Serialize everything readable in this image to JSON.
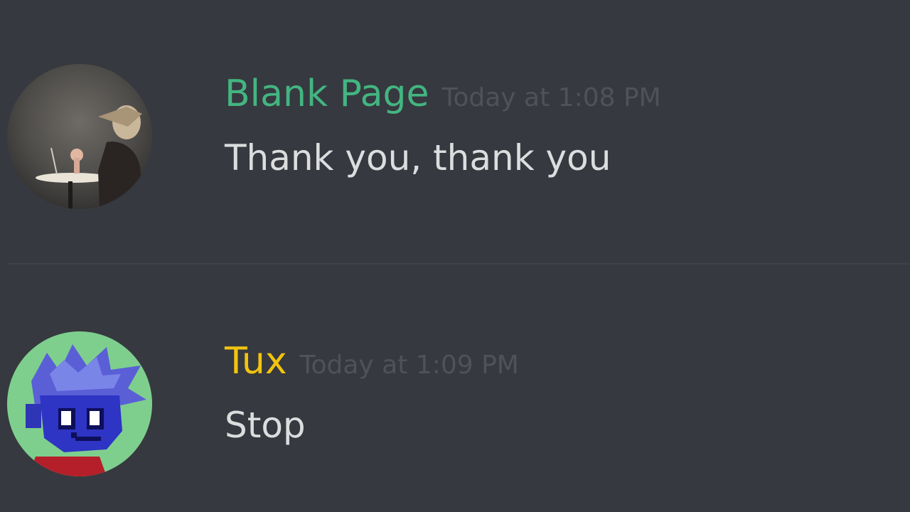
{
  "messages": [
    {
      "username": "Blank Page",
      "username_color": "#43b581",
      "timestamp": "Today at 1:08 PM",
      "text": "Thank you, thank you",
      "avatar_icon": "photo-avatar"
    },
    {
      "username": "Tux",
      "username_color": "#f1c40f",
      "timestamp": "Today at 1:09 PM",
      "text": "Stop",
      "avatar_icon": "pixel-character-avatar"
    }
  ],
  "colors": {
    "background": "#36393f",
    "timestamp": "#4f5258",
    "message_text": "#dcddde",
    "divider": "#3f4248"
  }
}
